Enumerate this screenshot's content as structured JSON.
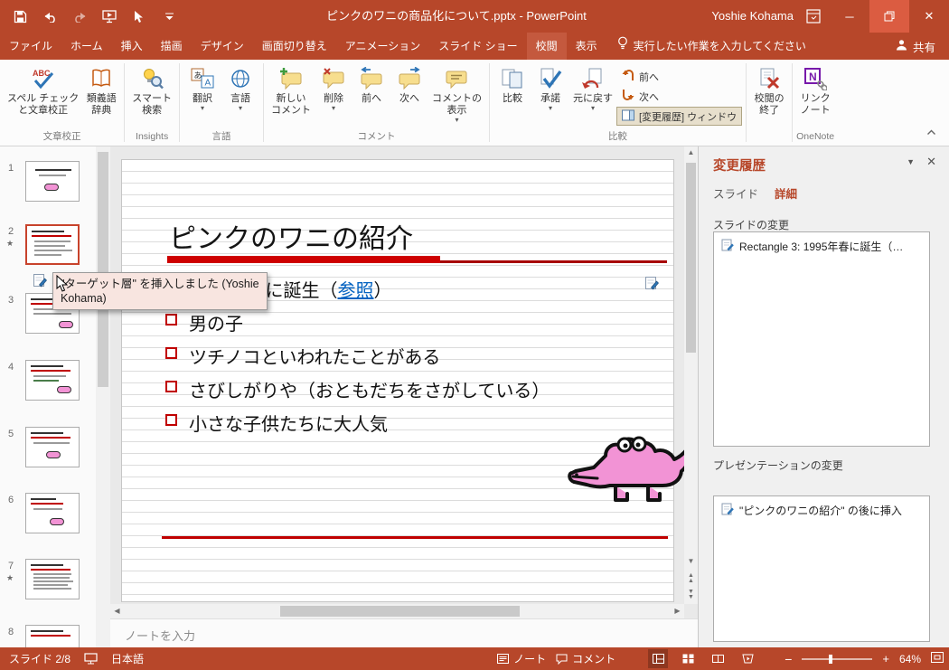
{
  "titlebar": {
    "title": "ピンクのワニの商品化について.pptx - PowerPoint",
    "user": "Yoshie Kohama"
  },
  "tabs": {
    "file": "ファイル",
    "home": "ホーム",
    "insert": "挿入",
    "draw": "描画",
    "design": "デザイン",
    "transitions": "画面切り替え",
    "animations": "アニメーション",
    "slideshow": "スライド ショー",
    "review": "校閲",
    "view": "表示",
    "tellme": "実行したい作業を入力してください",
    "share": "共有"
  },
  "ribbon": {
    "groups": {
      "proofing": "文章校正",
      "insights": "Insights",
      "language": "言語",
      "comments": "コメント",
      "compare": "比較",
      "onenote": "OneNote"
    },
    "spell1": "スペル チェック",
    "spell2": "と文章校正",
    "thes1": "類義語",
    "thes2": "辞典",
    "smart1": "スマート",
    "smart2": "検索",
    "translate": "翻訳",
    "language": "言語",
    "newc1": "新しい",
    "newc2": "コメント",
    "delete": "削除",
    "prev": "前へ",
    "next": "次へ",
    "showc1": "コメントの",
    "showc2": "表示",
    "compare": "比較",
    "accept": "承諾",
    "revert": "元に戻す",
    "prev_change": "前へ",
    "next_change": "次へ",
    "revpane_btn": "[変更履歴] ウィンドウ",
    "end1": "校閲の",
    "end2": "終了",
    "link1": "リンク",
    "link2": "ノート"
  },
  "panel": {
    "slides": [
      {
        "num": "1",
        "star": ""
      },
      {
        "num": "2",
        "star": "★"
      },
      {
        "num": "3",
        "star": ""
      },
      {
        "num": "4",
        "star": ""
      },
      {
        "num": "5",
        "star": ""
      },
      {
        "num": "6",
        "star": ""
      },
      {
        "num": "7",
        "star": "★"
      },
      {
        "num": "8",
        "star": ""
      }
    ]
  },
  "slide": {
    "title": "ピンクのワニの紹介",
    "bullet1_pre": "1995年春に誕生（",
    "bullet1_link": "参照",
    "bullet1_post": "）",
    "bullets": [
      "男の子",
      "ツチノコといわれたことがある",
      "さびしがりや（おともだちをさがしている）",
      "小さな子供たちに大人気"
    ]
  },
  "tooltip": {
    "text": "\"ターゲット層\" を挿入しました (Yoshie Kohama)"
  },
  "revisions": {
    "title": "変更履歴",
    "tab_slides": "スライド",
    "tab_details": "詳細",
    "slide_changes": "スライドの変更",
    "slide_change_item": "Rectangle 3: 1995年春に誕生（…",
    "pres_changes": "プレゼンテーションの変更",
    "pres_change_item": "\"ピンクのワニの紹介\" の後に挿入"
  },
  "notes": {
    "placeholder": "ノートを入力"
  },
  "status": {
    "slide_counter": "スライド 2/8",
    "language": "日本語",
    "notes_label": "ノート",
    "comments_label": "コメント",
    "zoom": "64%"
  },
  "colors": {
    "chrome_red": "#B7472A",
    "accent_red": "#C00000",
    "link_blue": "#0563C1",
    "croc_pink": "#F293D5"
  }
}
